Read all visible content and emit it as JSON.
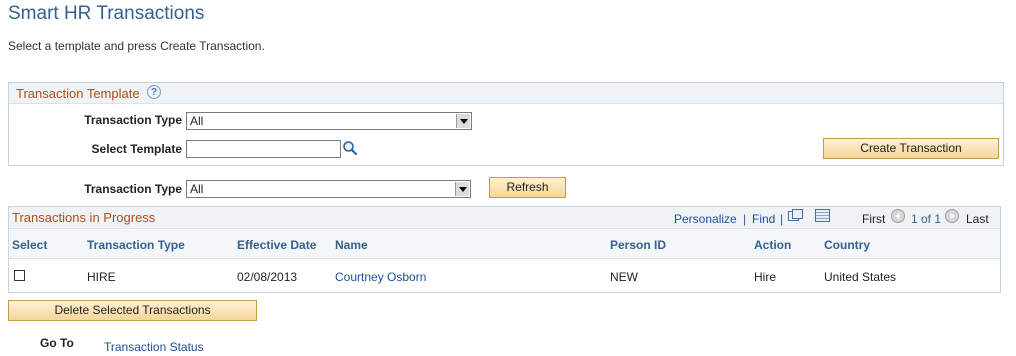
{
  "page": {
    "title": "Smart HR Transactions",
    "instructions": "Select a template and press Create Transaction."
  },
  "template_group": {
    "title": "Transaction Template",
    "help_icon": "?",
    "transaction_type_label": "Transaction Type",
    "transaction_type_value": "All",
    "select_template_label": "Select Template",
    "select_template_value": "",
    "create_button": "Create Transaction"
  },
  "filter": {
    "transaction_type_label": "Transaction Type",
    "transaction_type_value": "All",
    "refresh_button": "Refresh"
  },
  "grid": {
    "title": "Transactions in Progress",
    "personalize": "Personalize",
    "separator": "|",
    "find": "Find",
    "first": "First",
    "range": "1 of 1",
    "last": "Last",
    "columns": {
      "select": "Select",
      "transaction_type": "Transaction Type",
      "effective_date": "Effective Date",
      "name": "Name",
      "person_id": "Person ID",
      "action": "Action",
      "country": "Country"
    },
    "rows": [
      {
        "selected": false,
        "transaction_type": "HIRE",
        "effective_date": "02/08/2013",
        "name": "Courtney Osborn",
        "person_id": "NEW",
        "action": "Hire",
        "country": "United States"
      }
    ]
  },
  "delete_button": "Delete Selected Transactions",
  "goto": {
    "label": "Go To",
    "link": "Transaction Status"
  },
  "icons": {
    "lookup": "magnifier-icon",
    "zoom": "view-all-icon",
    "download": "download-grid-icon",
    "prev": "prev-arrow-icon",
    "next": "next-arrow-icon"
  }
}
